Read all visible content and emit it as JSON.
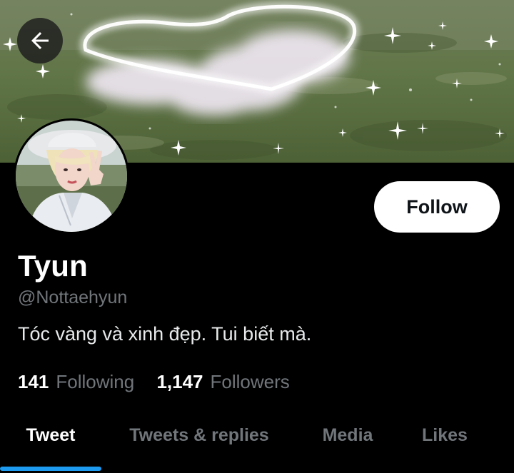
{
  "profile": {
    "display_name": "Tyun",
    "handle": "@Nottaehyun",
    "bio": "Tóc vàng và xinh đẹp. Tui biết mà.",
    "follow_label": "Follow"
  },
  "stats": {
    "following_count": "141",
    "following_label": "Following",
    "followers_count": "1,147",
    "followers_label": "Followers"
  },
  "tabs": [
    {
      "label": "Tweet",
      "active": true
    },
    {
      "label": "Tweets & replies",
      "active": false
    },
    {
      "label": "Media",
      "active": false
    },
    {
      "label": "Likes",
      "active": false
    }
  ],
  "icons": {
    "back": "arrow-left-icon"
  },
  "colors": {
    "background": "#000000",
    "accent": "#1d9bf0",
    "muted_text": "#71767b",
    "follow_button_bg": "#ffffff"
  }
}
